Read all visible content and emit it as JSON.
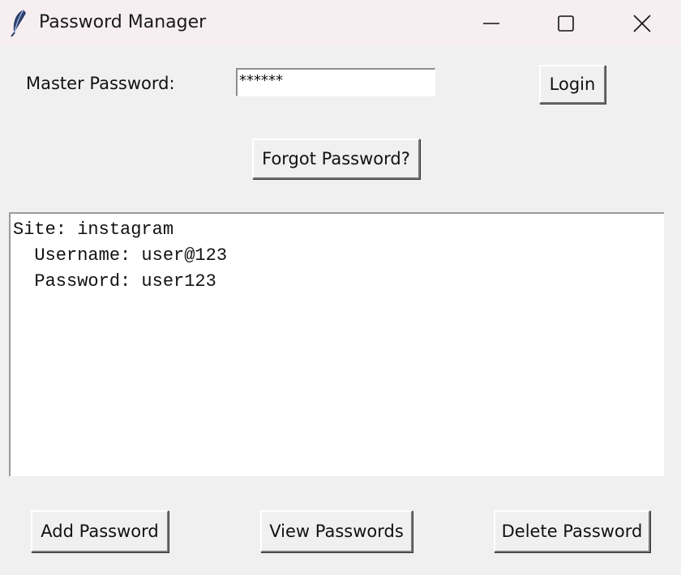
{
  "window": {
    "title": "Password Manager",
    "icon": "feather-icon",
    "controls": [
      "minimize-icon",
      "maximize-icon",
      "close-icon"
    ]
  },
  "login": {
    "master_label": "Master Password:",
    "master_value": "******",
    "login_button": "Login",
    "forgot_button": "Forgot Password?"
  },
  "output": {
    "lines": [
      "Site: instagram",
      "  Username: user@123",
      "  Password: user123"
    ]
  },
  "actions": {
    "add": "Add Password",
    "view": "View Passwords",
    "delete": "Delete Password"
  }
}
